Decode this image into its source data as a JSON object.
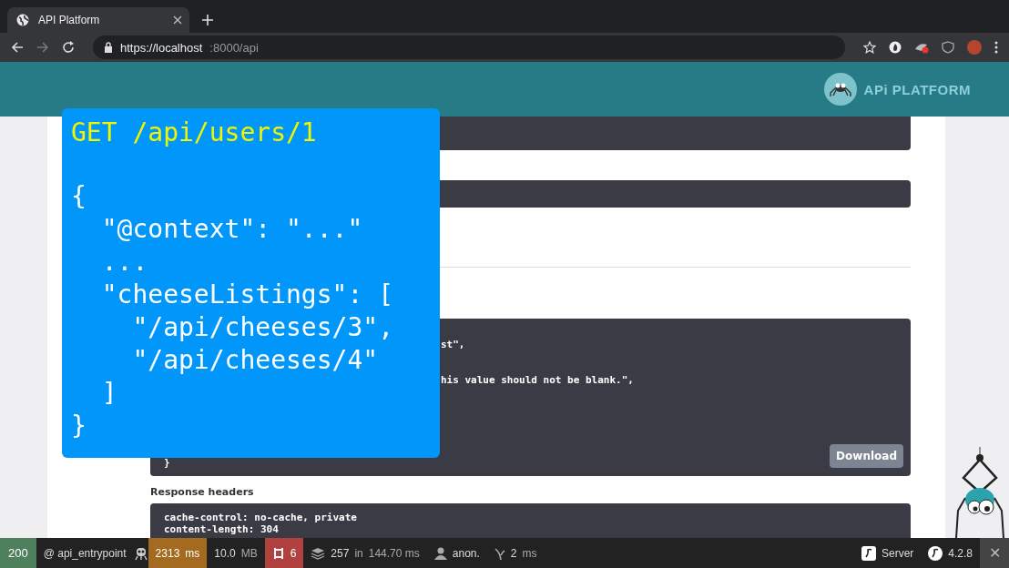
{
  "browser": {
    "tab": {
      "title": "API Platform",
      "selected": true
    },
    "url_host": "https://localhost",
    "url_rest": ":8000/api"
  },
  "header": {
    "logo_text": "APi PLATFORM"
  },
  "response_body": {
    "lines": [
      {
        "kind": "cut",
        "text": "st\","
      },
      {
        "kind": "cut",
        "text": "his value should not be blank.\","
      },
      {
        "kind": "full",
        "text": "}"
      }
    ],
    "download": "Download"
  },
  "response_headers": {
    "title": "Response headers",
    "lines": [
      "cache-control: no-cache, private",
      "content-length: 304"
    ]
  },
  "overlay": {
    "title": "GET /api/users/1",
    "lines": [
      "{",
      "  \"@context\": \"...\"",
      "  ...",
      "  \"cheeseListings\": [",
      "    \"/api/cheeses/3\",",
      "    \"/api/cheeses/4\"",
      "  ]",
      "}"
    ]
  },
  "toolbar": {
    "status": "200",
    "route": "@ api_entrypoint",
    "time": "2313",
    "time_unit": "ms",
    "memory": "10.0",
    "memory_unit": "MB",
    "requests": "6",
    "db_count": "257",
    "db_in": "in",
    "db_time": "144.70 ms",
    "user": "anon.",
    "twig": "2",
    "twig_unit": "ms",
    "server": "Server",
    "version": "4.2.8",
    "close": "✕"
  }
}
